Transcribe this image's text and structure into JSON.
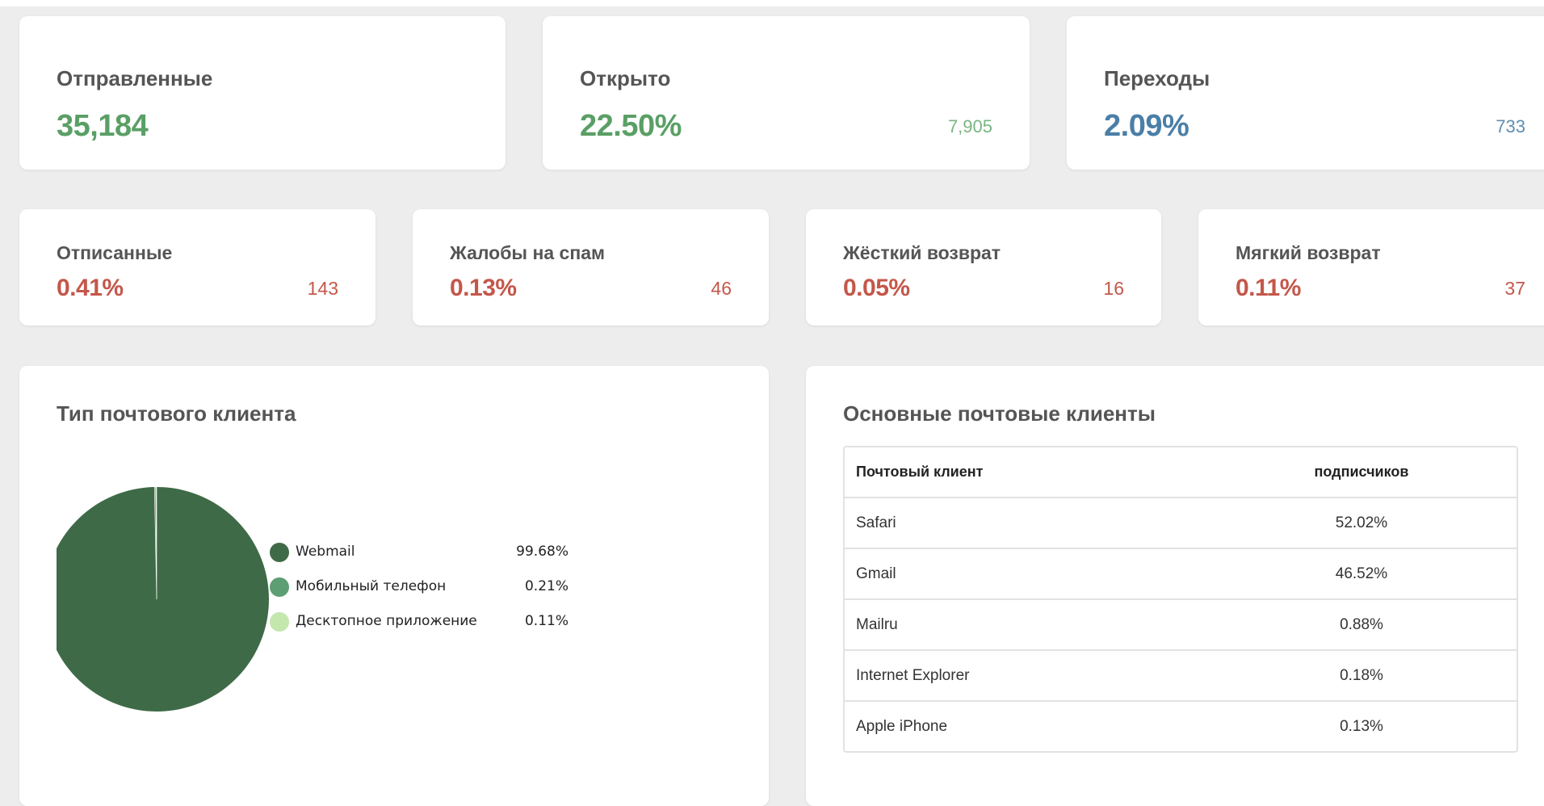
{
  "metrics_top": [
    {
      "title": "Отправленные",
      "value": "35,184",
      "count": ""
    },
    {
      "title": "Открыто",
      "value": "22.50%",
      "count": "7,905"
    },
    {
      "title": "Переходы",
      "value": "2.09%",
      "count": "733"
    }
  ],
  "metrics_bottom": [
    {
      "title": "Отписанные",
      "value": "0.41%",
      "count": "143"
    },
    {
      "title": "Жалобы на спам",
      "value": "0.13%",
      "count": "46"
    },
    {
      "title": "Жёсткий возврат",
      "value": "0.05%",
      "count": "16"
    },
    {
      "title": "Мягкий возврат",
      "value": "0.11%",
      "count": "37"
    }
  ],
  "colors": {
    "positive": "#5a9f65",
    "clicks": "#4a7fa7",
    "negative": "#c4574a",
    "pie_webmail": "#3f6a47",
    "pie_mobile": "#5d9e72",
    "pie_desktop": "#c3e7ad"
  },
  "client_type": {
    "title": "Тип почтового клиента",
    "legend": [
      {
        "label": "Webmail",
        "value": "99.68%"
      },
      {
        "label": "Мобильный телефон",
        "value": "0.21%"
      },
      {
        "label": "Десктопное приложение",
        "value": "0.11%"
      }
    ]
  },
  "chart_data": {
    "type": "pie",
    "title": "Тип почтового клиента",
    "categories": [
      "Webmail",
      "Мобильный телефон",
      "Десктопное приложение"
    ],
    "values": [
      99.68,
      0.21,
      0.11
    ],
    "legend_placement": "right"
  },
  "top_clients": {
    "title": "Основные почтовые клиенты",
    "columns": [
      "Почтовый клиент",
      "подписчиков"
    ],
    "rows": [
      [
        "Safari",
        "52.02%"
      ],
      [
        "Gmail",
        "46.52%"
      ],
      [
        "Mailru",
        "0.88%"
      ],
      [
        "Internet Explorer",
        "0.18%"
      ],
      [
        "Apple iPhone",
        "0.13%"
      ]
    ]
  }
}
